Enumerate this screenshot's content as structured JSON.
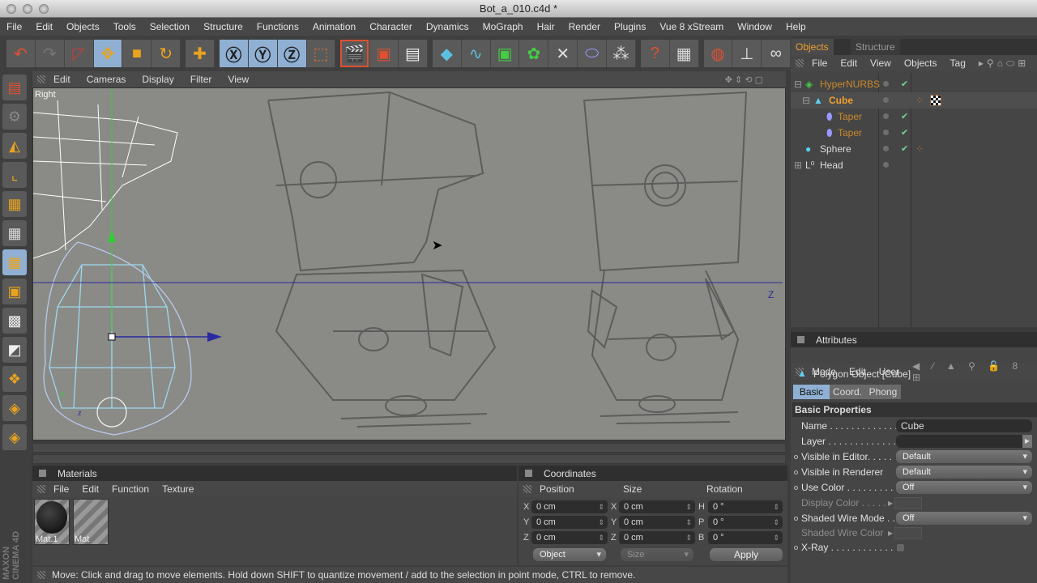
{
  "window": {
    "title": "Bot_a_010.c4d *"
  },
  "menubar": [
    "File",
    "Edit",
    "Objects",
    "Tools",
    "Selection",
    "Structure",
    "Functions",
    "Animation",
    "Character",
    "Dynamics",
    "MoGraph",
    "Hair",
    "Render",
    "Plugins",
    "Vue 8 xStream",
    "Window",
    "Help"
  ],
  "toolbar": {
    "icons": [
      "undo-icon",
      "redo-icon",
      "live-selection-icon",
      "move-icon",
      "scale-icon",
      "rotate-icon",
      "add-icon",
      "x-axis-icon",
      "y-axis-icon",
      "z-axis-icon",
      "coordinate-system-icon",
      "render-view-icon",
      "render-picture-viewer-icon",
      "render-settings-icon",
      "cube-icon",
      "spline-icon",
      "nurbs-icon",
      "array-icon",
      "deformer-icon",
      "scene-icon",
      "environment-icon",
      "help-icon",
      "timeline-icon",
      "globe-icon",
      "light-icon",
      "glasses-icon"
    ]
  },
  "viewport": {
    "menu": [
      "Edit",
      "Cameras",
      "Display",
      "Filter",
      "View"
    ],
    "label": "Right",
    "axis_label": "Z"
  },
  "materials": {
    "title": "Materials",
    "menu": [
      "File",
      "Edit",
      "Function",
      "Texture"
    ],
    "items": [
      "Mat.1",
      "Mat"
    ]
  },
  "coordinates": {
    "title": "Coordinates",
    "headers": [
      "Position",
      "Size",
      "Rotation"
    ],
    "position": [
      {
        "axis": "X",
        "value": "0 cm"
      },
      {
        "axis": "Y",
        "value": "0 cm"
      },
      {
        "axis": "Z",
        "value": "0 cm"
      }
    ],
    "size": [
      {
        "axis": "X",
        "value": "0 cm"
      },
      {
        "axis": "Y",
        "value": "0 cm"
      },
      {
        "axis": "Z",
        "value": "0 cm"
      }
    ],
    "rotation": [
      {
        "axis": "H",
        "value": "0 °"
      },
      {
        "axis": "P",
        "value": "0 °"
      },
      {
        "axis": "B",
        "value": "0 °"
      }
    ],
    "mode": "Object",
    "size_mode": "Size",
    "apply": "Apply"
  },
  "status": "Move: Click and drag to move elements. Hold down SHIFT to quantize movement / add to the selection in point mode, CTRL to remove.",
  "objects": {
    "tabs": [
      "Objects",
      "Structure"
    ],
    "menu": [
      "File",
      "Edit",
      "View",
      "Objects",
      "Tag"
    ],
    "tree": [
      {
        "name": "HyperNURBS",
        "color": "#c98a2c"
      },
      {
        "name": "Cube",
        "color": "#f0a030"
      },
      {
        "name": "Taper",
        "color": "#c98a2c"
      },
      {
        "name": "Taper",
        "color": "#c98a2c"
      },
      {
        "name": "Sphere",
        "color": "#dddddd"
      },
      {
        "name": "Head",
        "color": "#dddddd"
      }
    ]
  },
  "attributes": {
    "title": "Attributes",
    "menu": [
      "Mode",
      "Edit",
      "User"
    ],
    "object": "Polygon Object [Cube]",
    "tabs": [
      "Basic",
      "Coord.",
      "Phong"
    ],
    "section": "Basic Properties",
    "fields": [
      {
        "label": "Name . . . . . . . . . . . . .",
        "value": "Cube"
      },
      {
        "label": "Layer . . . . . . . . . . . . .",
        "value": ""
      },
      {
        "label": "Visible in Editor. . . . .",
        "value": "Default"
      },
      {
        "label": "Visible in Renderer",
        "value": "Default"
      },
      {
        "label": "Use Color . . . . . . . . .",
        "value": "Off"
      },
      {
        "label": "Display Color . . . . .",
        "value": ""
      },
      {
        "label": "Shaded Wire Mode . .",
        "value": "Off"
      },
      {
        "label": "Shaded Wire Color",
        "value": ""
      },
      {
        "label": "X-Ray . . . . . . . . . . . .",
        "value": ""
      }
    ]
  },
  "logo": "MAXON CINEMA 4D"
}
